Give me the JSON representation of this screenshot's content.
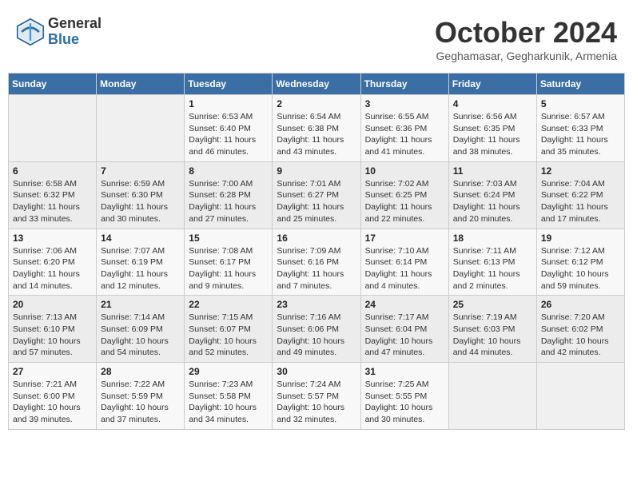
{
  "header": {
    "logo_general": "General",
    "logo_blue": "Blue",
    "month_title": "October 2024",
    "subtitle": "Geghamasar, Gegharkunik, Armenia"
  },
  "weekdays": [
    "Sunday",
    "Monday",
    "Tuesday",
    "Wednesday",
    "Thursday",
    "Friday",
    "Saturday"
  ],
  "weeks": [
    [
      {
        "day": "",
        "detail": ""
      },
      {
        "day": "",
        "detail": ""
      },
      {
        "day": "1",
        "detail": "Sunrise: 6:53 AM\nSunset: 6:40 PM\nDaylight: 11 hours and 46 minutes."
      },
      {
        "day": "2",
        "detail": "Sunrise: 6:54 AM\nSunset: 6:38 PM\nDaylight: 11 hours and 43 minutes."
      },
      {
        "day": "3",
        "detail": "Sunrise: 6:55 AM\nSunset: 6:36 PM\nDaylight: 11 hours and 41 minutes."
      },
      {
        "day": "4",
        "detail": "Sunrise: 6:56 AM\nSunset: 6:35 PM\nDaylight: 11 hours and 38 minutes."
      },
      {
        "day": "5",
        "detail": "Sunrise: 6:57 AM\nSunset: 6:33 PM\nDaylight: 11 hours and 35 minutes."
      }
    ],
    [
      {
        "day": "6",
        "detail": "Sunrise: 6:58 AM\nSunset: 6:32 PM\nDaylight: 11 hours and 33 minutes."
      },
      {
        "day": "7",
        "detail": "Sunrise: 6:59 AM\nSunset: 6:30 PM\nDaylight: 11 hours and 30 minutes."
      },
      {
        "day": "8",
        "detail": "Sunrise: 7:00 AM\nSunset: 6:28 PM\nDaylight: 11 hours and 27 minutes."
      },
      {
        "day": "9",
        "detail": "Sunrise: 7:01 AM\nSunset: 6:27 PM\nDaylight: 11 hours and 25 minutes."
      },
      {
        "day": "10",
        "detail": "Sunrise: 7:02 AM\nSunset: 6:25 PM\nDaylight: 11 hours and 22 minutes."
      },
      {
        "day": "11",
        "detail": "Sunrise: 7:03 AM\nSunset: 6:24 PM\nDaylight: 11 hours and 20 minutes."
      },
      {
        "day": "12",
        "detail": "Sunrise: 7:04 AM\nSunset: 6:22 PM\nDaylight: 11 hours and 17 minutes."
      }
    ],
    [
      {
        "day": "13",
        "detail": "Sunrise: 7:06 AM\nSunset: 6:20 PM\nDaylight: 11 hours and 14 minutes."
      },
      {
        "day": "14",
        "detail": "Sunrise: 7:07 AM\nSunset: 6:19 PM\nDaylight: 11 hours and 12 minutes."
      },
      {
        "day": "15",
        "detail": "Sunrise: 7:08 AM\nSunset: 6:17 PM\nDaylight: 11 hours and 9 minutes."
      },
      {
        "day": "16",
        "detail": "Sunrise: 7:09 AM\nSunset: 6:16 PM\nDaylight: 11 hours and 7 minutes."
      },
      {
        "day": "17",
        "detail": "Sunrise: 7:10 AM\nSunset: 6:14 PM\nDaylight: 11 hours and 4 minutes."
      },
      {
        "day": "18",
        "detail": "Sunrise: 7:11 AM\nSunset: 6:13 PM\nDaylight: 11 hours and 2 minutes."
      },
      {
        "day": "19",
        "detail": "Sunrise: 7:12 AM\nSunset: 6:12 PM\nDaylight: 10 hours and 59 minutes."
      }
    ],
    [
      {
        "day": "20",
        "detail": "Sunrise: 7:13 AM\nSunset: 6:10 PM\nDaylight: 10 hours and 57 minutes."
      },
      {
        "day": "21",
        "detail": "Sunrise: 7:14 AM\nSunset: 6:09 PM\nDaylight: 10 hours and 54 minutes."
      },
      {
        "day": "22",
        "detail": "Sunrise: 7:15 AM\nSunset: 6:07 PM\nDaylight: 10 hours and 52 minutes."
      },
      {
        "day": "23",
        "detail": "Sunrise: 7:16 AM\nSunset: 6:06 PM\nDaylight: 10 hours and 49 minutes."
      },
      {
        "day": "24",
        "detail": "Sunrise: 7:17 AM\nSunset: 6:04 PM\nDaylight: 10 hours and 47 minutes."
      },
      {
        "day": "25",
        "detail": "Sunrise: 7:19 AM\nSunset: 6:03 PM\nDaylight: 10 hours and 44 minutes."
      },
      {
        "day": "26",
        "detail": "Sunrise: 7:20 AM\nSunset: 6:02 PM\nDaylight: 10 hours and 42 minutes."
      }
    ],
    [
      {
        "day": "27",
        "detail": "Sunrise: 7:21 AM\nSunset: 6:00 PM\nDaylight: 10 hours and 39 minutes."
      },
      {
        "day": "28",
        "detail": "Sunrise: 7:22 AM\nSunset: 5:59 PM\nDaylight: 10 hours and 37 minutes."
      },
      {
        "day": "29",
        "detail": "Sunrise: 7:23 AM\nSunset: 5:58 PM\nDaylight: 10 hours and 34 minutes."
      },
      {
        "day": "30",
        "detail": "Sunrise: 7:24 AM\nSunset: 5:57 PM\nDaylight: 10 hours and 32 minutes."
      },
      {
        "day": "31",
        "detail": "Sunrise: 7:25 AM\nSunset: 5:55 PM\nDaylight: 10 hours and 30 minutes."
      },
      {
        "day": "",
        "detail": ""
      },
      {
        "day": "",
        "detail": ""
      }
    ]
  ]
}
